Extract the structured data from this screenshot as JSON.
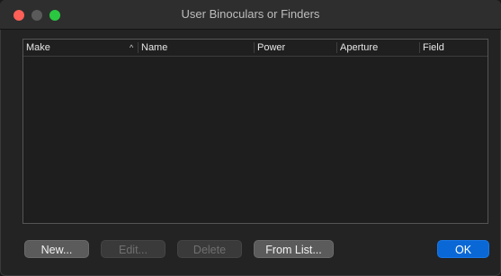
{
  "window": {
    "title": "User Binoculars or Finders"
  },
  "table": {
    "columns": [
      {
        "label": "Make",
        "sorted": "ascending"
      },
      {
        "label": "Name"
      },
      {
        "label": "Power"
      },
      {
        "label": "Aperture"
      },
      {
        "label": "Field"
      }
    ],
    "sort_indicator": "^",
    "rows": []
  },
  "buttons": {
    "new": {
      "label": "New...",
      "enabled": true
    },
    "edit": {
      "label": "Edit...",
      "enabled": false
    },
    "delete": {
      "label": "Delete",
      "enabled": false
    },
    "from_list": {
      "label": "From List...",
      "enabled": true
    },
    "ok": {
      "label": "OK",
      "enabled": true
    }
  },
  "colors": {
    "accent": "#0a68d6",
    "close": "#fe5f57",
    "zoom": "#2ac840"
  }
}
